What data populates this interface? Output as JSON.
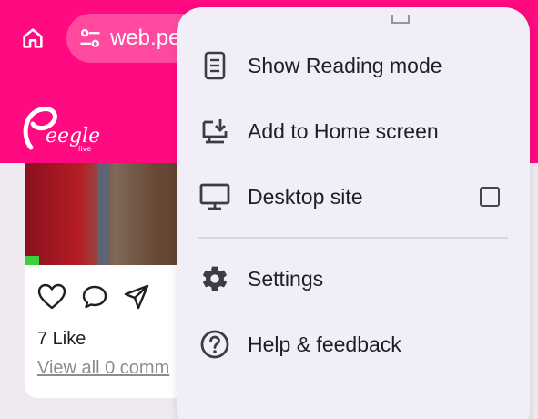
{
  "browser": {
    "url_text": "web.pe",
    "icons": {
      "home": "home-icon",
      "site_info": "tune-icon"
    },
    "colors": {
      "toolbar": "#ff0a80",
      "url_pill": "#ff4aa0"
    }
  },
  "site": {
    "logo_text": "Peegle",
    "logo_sub": "live",
    "post": {
      "likes": "7 Like",
      "comments_link": "View all 0 comm"
    }
  },
  "menu": {
    "items": [
      {
        "label": "Show Reading mode",
        "icon": "reading-mode-icon"
      },
      {
        "label": "Add to Home screen",
        "icon": "add-to-home-screen-icon"
      },
      {
        "label": "Desktop site",
        "icon": "desktop-icon",
        "checked": false
      },
      {
        "label": "Settings",
        "icon": "gear-icon"
      },
      {
        "label": "Help & feedback",
        "icon": "help-icon"
      }
    ],
    "background": "#f2eef8"
  }
}
